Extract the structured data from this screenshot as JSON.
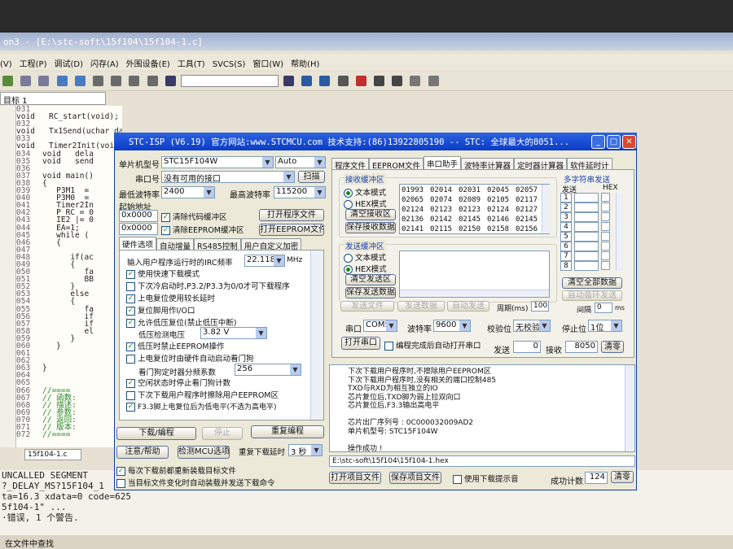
{
  "ide": {
    "title": "on3 - [E:\\stc-soft\\15f104\\15f104-1.c]",
    "menu": [
      "(V)",
      "工程(P)",
      "调试(D)",
      "闪存(A)",
      "外围设备(E)",
      "工具(T)",
      "SVCS(S)",
      "窗口(W)",
      "帮助(H)"
    ],
    "target": "目标 1",
    "code_lines": [
      {
        "ln": "031",
        "text": "void   RC_start(void);"
      },
      {
        "ln": "032",
        "text": "void   Tx1Send(uchar dat);"
      },
      {
        "ln": "033",
        "text": "void   Timer2Init(void);"
      },
      {
        "ln": "034",
        "text": "void   dela"
      },
      {
        "ln": "035",
        "text": "void   send"
      },
      {
        "ln": "036",
        "text": ""
      },
      {
        "ln": "037",
        "text": "void main()"
      },
      {
        "ln": "038",
        "text": "{"
      },
      {
        "ln": "039",
        "text": "   P3M1  ="
      },
      {
        "ln": "040",
        "text": "   P3M0  ="
      },
      {
        "ln": "041",
        "text": "   Timer2In"
      },
      {
        "ln": "042",
        "text": "   P_RC = 0"
      },
      {
        "ln": "043",
        "text": "   IE2 |= 0"
      },
      {
        "ln": "044",
        "text": "   EA=1;"
      },
      {
        "ln": "045",
        "text": "   while ("
      },
      {
        "ln": "046",
        "text": "   {"
      },
      {
        "ln": "047",
        "text": ""
      },
      {
        "ln": "048",
        "text": "      if(ac"
      },
      {
        "ln": "049",
        "text": "      {"
      },
      {
        "ln": "050",
        "text": "         fa"
      },
      {
        "ln": "051",
        "text": "         BB"
      },
      {
        "ln": "052",
        "text": "      }"
      },
      {
        "ln": "053",
        "text": "      else"
      },
      {
        "ln": "054",
        "text": "      {"
      },
      {
        "ln": "055",
        "text": "         fa"
      },
      {
        "ln": "056",
        "text": "         if"
      },
      {
        "ln": "057",
        "text": "         if"
      },
      {
        "ln": "058",
        "text": "         el"
      },
      {
        "ln": "059",
        "text": "      }"
      },
      {
        "ln": "060",
        "text": "   }"
      },
      {
        "ln": "061",
        "text": ""
      },
      {
        "ln": "062",
        "text": ""
      },
      {
        "ln": "063",
        "text": "}"
      },
      {
        "ln": "064",
        "text": ""
      },
      {
        "ln": "065",
        "text": ""
      },
      {
        "ln": "066",
        "text": "//===="
      },
      {
        "ln": "067",
        "text": "// 函数:"
      },
      {
        "ln": "068",
        "text": "// 描述:"
      },
      {
        "ln": "069",
        "text": "// 参数:"
      },
      {
        "ln": "070",
        "text": "// 返回:"
      },
      {
        "ln": "071",
        "text": "// 版本:"
      },
      {
        "ln": "072",
        "text": "//===="
      }
    ],
    "file_tab": "15f104-1.c",
    "output_lines": [
      " UNCALLED SEGMENT",
      "?_DELAY_MS?15F104_1",
      "ta=16.3 xdata=0 code=625",
      "5f104-1\" ...",
      "·错误, 1 个警告."
    ],
    "status_bar": "在文件中查找"
  },
  "isp": {
    "title": "STC-ISP (V6.19) 官方网站:www.STCMCU.com 技术支持:(86)13922805190 -- STC: 全球最大的8051...",
    "mcu_label": "单片机型号",
    "mcu_value": "STC15F104W",
    "mcu_auto": "Auto",
    "port_label": "串口号",
    "port_value": "没有可用的接口",
    "scan_btn": "扫描",
    "min_baud_label": "最低波特率",
    "min_baud_value": "2400",
    "max_baud_label": "最高波特率",
    "max_baud_value": "115200",
    "start_addr_label": "起始地址",
    "addr1": "0x0000",
    "addr2": "0x0000",
    "clear_code_chk": "清除代码缓冲区",
    "clear_eeprom_chk": "清除EEPROM缓冲区",
    "open_prog_btn": "打开程序文件",
    "open_eeprom_btn": "打开EEPROM文件",
    "left_tabs": [
      "硬件选项",
      "自动增量",
      "RS485控制",
      "用户自定义加密"
    ],
    "irc_label": "输入用户程序运行时的IRC频率",
    "irc_value": "22.1184",
    "irc_unit": "MHz",
    "options": [
      {
        "label": "使用快速下载模式",
        "checked": true
      },
      {
        "label": "下次冷启动时,P3.2/P3.3为0/0才可下载程序",
        "checked": false
      },
      {
        "label": "上电复位使用较长延时",
        "checked": true
      },
      {
        "label": "复位脚用作I/O口",
        "checked": true
      },
      {
        "label": "允许低压复位(禁止低压中断)",
        "checked": true
      }
    ],
    "lvd_label": "低压检测电压",
    "lvd_value": "3.82 V",
    "opt_eeprom": "低压时禁止EEPROM操作",
    "opt_wdt": "上电复位时由硬件自动启动看门狗",
    "wdt_div_label": "看门狗定时器分频系数",
    "wdt_div_value": "256",
    "opt_idle": "空闲状态时停止看门狗计数",
    "opt_erase": "下次下载用户程序时擦除用户EEPROM区",
    "opt_p33": "F3.3脚上电复位后为低电平(不选为高电平)",
    "download_btn": "下载/编程",
    "stop_btn": "停止",
    "redownload_btn": "重复编程",
    "help_btn": "注意/帮助",
    "check_mcu_btn": "检测MCU选项",
    "repeat_delay_label": "重复下载延时",
    "repeat_delay_value": "3 秒",
    "reload_chk": "每次下载前都重新装载目标文件",
    "auto_send_chk": "当目标文件变化时自动装载并发送下载命令",
    "right_tabs": [
      "程序文件",
      "EEPROM文件",
      "串口助手",
      "波特率计算器",
      "定时器计算器",
      "软件延时计"
    ],
    "recv_title": "接收缓冲区",
    "text_mode": "文本模式",
    "hex_mode": "HEX模式",
    "clear_recv_btn": "清空接收区",
    "save_recv_btn": "保存接收数据",
    "recv_rows": [
      [
        "01993",
        "02014",
        "02031",
        "02045",
        "02057"
      ],
      [
        "02065",
        "02074",
        "02089",
        "02105",
        "02117"
      ],
      [
        "02124",
        "02123",
        "02123",
        "02124",
        "02127"
      ],
      [
        "02136",
        "02142",
        "02145",
        "02146",
        "02145"
      ],
      [
        "02141",
        "02115",
        "02150",
        "02158",
        "02156"
      ]
    ],
    "send_title": "发送缓冲区",
    "clear_send_btn": "清空发送区",
    "save_send_btn": "保存发送数据",
    "send_file_btn": "发送文件",
    "send_data_btn": "发送数据",
    "auto_send_btn": "自动发送",
    "period_label": "周期(ms)",
    "period_value": "100",
    "multi_title": "多字符串发送",
    "send_col": "发送",
    "hex_col": "HEX",
    "multi_rows": [
      "1",
      "2",
      "3",
      "4",
      "5",
      "6",
      "7",
      "8"
    ],
    "clear_all_btn": "清空全部数据",
    "auto_loop_btn": "自动循环发送",
    "interval_label": "间隔",
    "interval_value": "0",
    "interval_unit": "ms",
    "com_label": "串口",
    "com_value": "COM5",
    "baud_label": "波特率",
    "baud_value": "9600",
    "parity_label": "校验位",
    "parity_value": "无校验",
    "stopbit_label": "停止位",
    "stopbit_value": "1位",
    "open_port_btn": "打开串口",
    "auto_open_chk": "编程完成后自动打开串口",
    "sent_label": "发送",
    "sent_value": "0",
    "recv_label": "接收",
    "recv_value": "8050",
    "clear_cnt_btn": "清零",
    "log_lines": [
      "下次下载用户程序时,不擦除用户EEPROM区",
      "下次下载用户程序时,没有相关的端口控制485",
      "TXD与RXD为相互独立的IO",
      "芯片复位后,TXD脚为弱上拉双向口",
      "芯片复位后,F3.3输出高电平",
      "",
      "芯片出厂序列号 : 0C000032009AD2",
      "单片机型号: STC15F104W",
      "",
      "操作成功 !"
    ],
    "file_path": "E:\\stc-soft\\15f104\\15f104-1.hex",
    "open_proj_btn": "打开项目文件",
    "save_proj_btn": "保存项目文件",
    "download_tip_chk": "使用下载提示音",
    "success_label": "成功计数",
    "success_value": "124",
    "clear_success_btn": "清零"
  }
}
